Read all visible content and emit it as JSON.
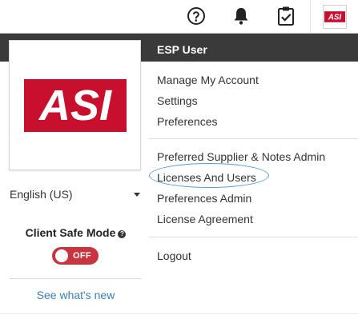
{
  "topbar": {
    "icons": [
      "help-circle-icon",
      "bell-icon",
      "clipboard-check-icon"
    ],
    "avatar_logo_text": "ASI"
  },
  "dropdown": {
    "user_name": "ESP User",
    "logo_text": "ASI",
    "logo_color": "#c8102e",
    "language": "English (US)",
    "client_safe_mode_label": "Client Safe Mode",
    "client_safe_mode_state": "OFF",
    "toggle_color": "#c9353f",
    "see_whats_new": "See what's new",
    "account_items": [
      "Manage My Account",
      "Settings",
      "Preferences"
    ],
    "admin_items": [
      "Preferred Supplier & Notes Admin",
      "Licenses And Users",
      "Preferences Admin",
      "License Agreement"
    ],
    "logout": "Logout",
    "highlighted_item": "Licenses And Users",
    "highlight_color": "#5b9bd5",
    "header_color": "#3a3a3a"
  }
}
